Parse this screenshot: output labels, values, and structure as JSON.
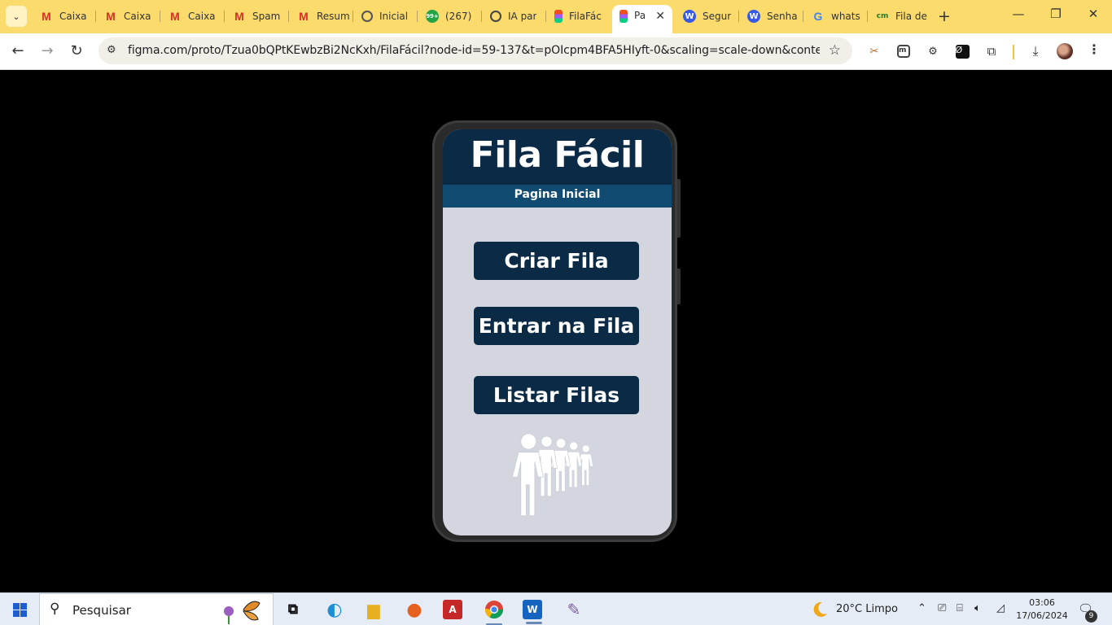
{
  "browser": {
    "tabs": [
      {
        "title": "Caixa",
        "icon": "M"
      },
      {
        "title": "Caixa",
        "icon": "M"
      },
      {
        "title": "Caixa",
        "icon": "M"
      },
      {
        "title": "Spam",
        "icon": "M"
      },
      {
        "title": "Resum",
        "icon": "M"
      },
      {
        "title": "Inicial",
        "icon": ""
      },
      {
        "title": "(267)",
        "icon": "99+"
      },
      {
        "title": "IA par",
        "icon": ""
      },
      {
        "title": "FilaFác",
        "icon": ""
      },
      {
        "title": "Pa",
        "icon": ""
      },
      {
        "title": "Segur",
        "icon": "W"
      },
      {
        "title": "Senha",
        "icon": "W"
      },
      {
        "title": "whats",
        "icon": "G"
      },
      {
        "title": "Fila de",
        "icon": "cm"
      }
    ],
    "active_tab_index": 9,
    "new_tab": "+",
    "window_controls": {
      "minimize": "—",
      "restore": "❐",
      "close": "✕"
    },
    "url": "figma.com/proto/Tzua0bQPtKEwbzBi2NcKxh/FilaFácil?node-id=59-137&t=pOIcpm4BFA5HIyft-0&scaling=scale-down&content-scaling=..."
  },
  "app": {
    "title": "Fila Fácil",
    "subtitle": "Pagina Inicial",
    "buttons": {
      "create": "Criar Fila",
      "join": "Entrar na Fila",
      "list": "Listar Filas"
    }
  },
  "taskbar": {
    "search_placeholder": "Pesquisar",
    "weather": "20°C  Limpo",
    "time": "03:06",
    "date": "17/06/2024",
    "notification_count": "9"
  },
  "colors": {
    "header": "#0b2a45",
    "subbar": "#124b72",
    "screen_bg": "#d3d6de",
    "button": "#0b2a45",
    "tabstrip": "#fadb6c"
  }
}
